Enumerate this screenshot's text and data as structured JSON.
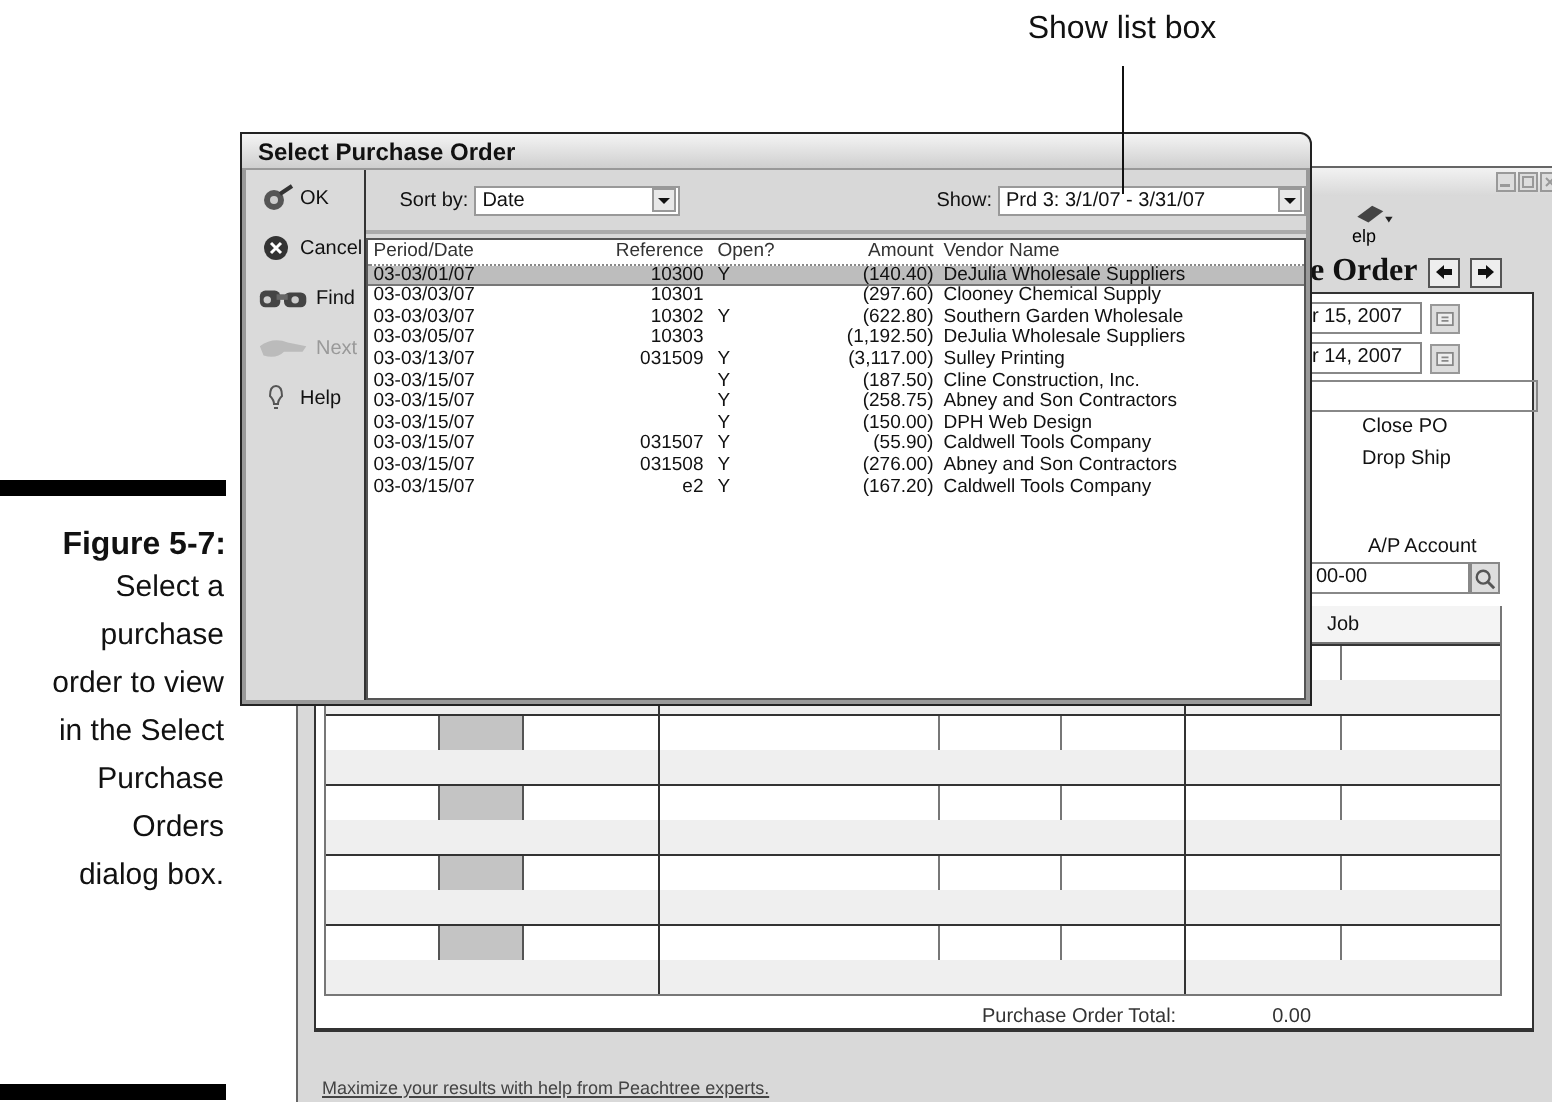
{
  "annotation": {
    "text": "Show list box"
  },
  "caption": {
    "label": "Figure 5-7:",
    "text": "Select a purchase order to view in the Select Purchase Orders dialog box."
  },
  "background_window": {
    "toolbar_button": "elp",
    "heading": "e Order",
    "date_fields": [
      "r 15, 2007",
      "r 14, 2007"
    ],
    "options": [
      "Close PO",
      "Drop Ship"
    ],
    "ap_account_label": "A/P Account",
    "ap_account_value": "00-00",
    "grid_column": "Job",
    "total_label": "Purchase Order Total:",
    "total_value": "0.00",
    "footer_link": "Maximize your results with help from Peachtree experts."
  },
  "dialog": {
    "title": "Select Purchase Order",
    "buttons": [
      {
        "label": "OK",
        "kind": "ok",
        "disabled": false
      },
      {
        "label": "Cancel",
        "kind": "cancel",
        "disabled": false
      },
      {
        "label": "Find",
        "kind": "find",
        "disabled": false
      },
      {
        "label": "Next",
        "kind": "next",
        "disabled": true
      },
      {
        "label": "Help",
        "kind": "help",
        "disabled": false
      }
    ],
    "sort_by": {
      "label": "Sort by:",
      "value": "Date"
    },
    "show": {
      "label": "Show:",
      "value": "Prd 3: 3/1/07 - 3/31/07"
    },
    "columns": [
      "Period/Date",
      "Reference",
      "Open?",
      "Amount",
      "Vendor Name"
    ],
    "rows": [
      {
        "date": "03-03/01/07",
        "reference": "10300",
        "open": "Y",
        "amount": "(140.40)",
        "vendor": "DeJulia Wholesale Suppliers",
        "selected": true
      },
      {
        "date": "03-03/03/07",
        "reference": "10301",
        "open": "",
        "amount": "(297.60)",
        "vendor": "Clooney Chemical Supply",
        "selected": false
      },
      {
        "date": "03-03/03/07",
        "reference": "10302",
        "open": "Y",
        "amount": "(622.80)",
        "vendor": "Southern Garden Wholesale",
        "selected": false
      },
      {
        "date": "03-03/05/07",
        "reference": "10303",
        "open": "",
        "amount": "(1,192.50)",
        "vendor": "DeJulia Wholesale Suppliers",
        "selected": false
      },
      {
        "date": "03-03/13/07",
        "reference": "031509",
        "open": "Y",
        "amount": "(3,117.00)",
        "vendor": "Sulley Printing",
        "selected": false
      },
      {
        "date": "03-03/15/07",
        "reference": "",
        "open": "Y",
        "amount": "(187.50)",
        "vendor": "Cline Construction, Inc.",
        "selected": false
      },
      {
        "date": "03-03/15/07",
        "reference": "",
        "open": "Y",
        "amount": "(258.75)",
        "vendor": "Abney and Son Contractors",
        "selected": false
      },
      {
        "date": "03-03/15/07",
        "reference": "",
        "open": "Y",
        "amount": "(150.00)",
        "vendor": "DPH Web Design",
        "selected": false
      },
      {
        "date": "03-03/15/07",
        "reference": "031507",
        "open": "Y",
        "amount": "(55.90)",
        "vendor": "Caldwell Tools Company",
        "selected": false
      },
      {
        "date": "03-03/15/07",
        "reference": "031508",
        "open": "Y",
        "amount": "(276.00)",
        "vendor": "Abney and Son Contractors",
        "selected": false
      },
      {
        "date": "03-03/15/07",
        "reference": "e2",
        "open": "Y",
        "amount": "(167.20)",
        "vendor": "Caldwell Tools Company",
        "selected": false
      }
    ]
  }
}
